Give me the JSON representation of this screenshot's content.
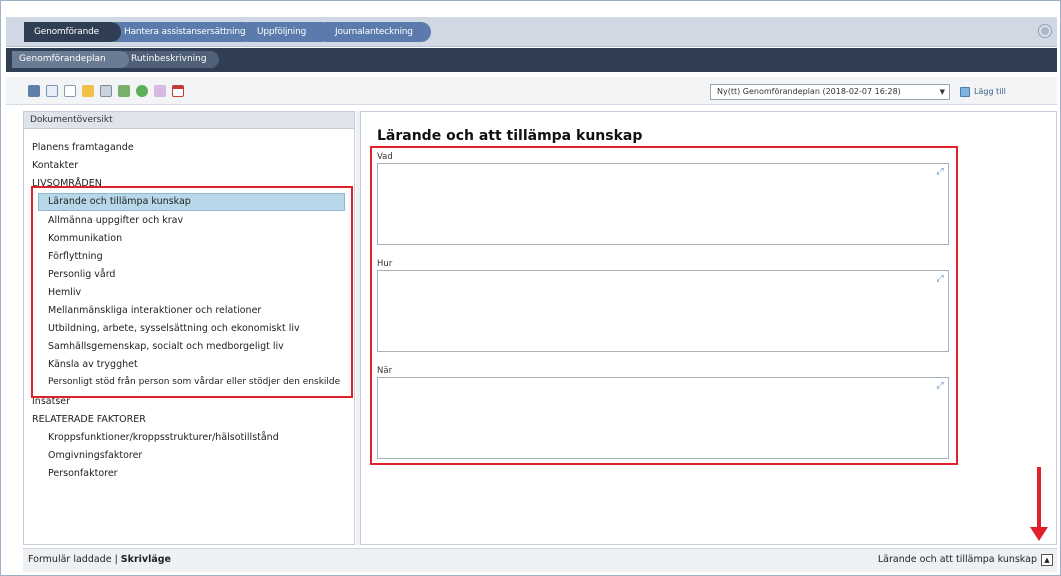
{
  "top_tabs": [
    {
      "label": "Genomförande"
    },
    {
      "label": "Hantera assistansersättning"
    },
    {
      "label": "Uppföljning"
    },
    {
      "label": "Journalanteckning"
    }
  ],
  "sub_tabs": [
    {
      "label": "Genomförandeplan"
    },
    {
      "label": "Rutinbeskrivning"
    }
  ],
  "toolbar": {
    "icons": [
      "save-icon",
      "document-icon",
      "page-icon",
      "folder-icon",
      "print-icon",
      "image-icon",
      "refresh-icon",
      "filter-icon",
      "calendar-icon"
    ],
    "plan_select": "Ny(tt) Genomförandeplan (2018-02-07 16:28)",
    "add_label": "Lägg till"
  },
  "left": {
    "header": "Dokumentöversikt",
    "items": [
      {
        "label": "Planens framtagande"
      },
      {
        "label": "Kontakter"
      },
      {
        "label": "LIVSOMRÅDEN"
      },
      {
        "label": "Lärande och tillämpa kunskap"
      },
      {
        "label": "Allmänna uppgifter och krav"
      },
      {
        "label": "Kommunikation"
      },
      {
        "label": "Förflyttning"
      },
      {
        "label": "Personlig vård"
      },
      {
        "label": "Hemliv"
      },
      {
        "label": "Mellanmänskliga interaktioner och relationer"
      },
      {
        "label": "Utbildning, arbete, sysselsättning och ekonomiskt liv"
      },
      {
        "label": "Samhällsgemenskap, socialt och medborgeligt liv"
      },
      {
        "label": "Känsla av trygghet"
      },
      {
        "label": "Personligt stöd från person som vårdar eller stödjer den enskilde"
      },
      {
        "label": "Insatser"
      },
      {
        "label": "RELATERADE FAKTORER"
      },
      {
        "label": "Kroppsfunktioner/kroppsstrukturer/hälsotillstånd"
      },
      {
        "label": "Omgivningsfaktorer"
      },
      {
        "label": "Personfaktorer"
      }
    ]
  },
  "main": {
    "title": "Lärande och att tillämpa kunskap",
    "fields": [
      {
        "label": "Vad",
        "value": ""
      },
      {
        "label": "Hur",
        "value": ""
      },
      {
        "label": "När",
        "value": ""
      }
    ]
  },
  "status": {
    "left_a": "Formulär laddade | ",
    "left_b": "Skrivläge",
    "right": "Lärande och att tillämpa kunskap"
  },
  "colors": {
    "accent": "#4b6fa0",
    "highlight": "#e0202b",
    "selected": "#b8d8ea"
  }
}
